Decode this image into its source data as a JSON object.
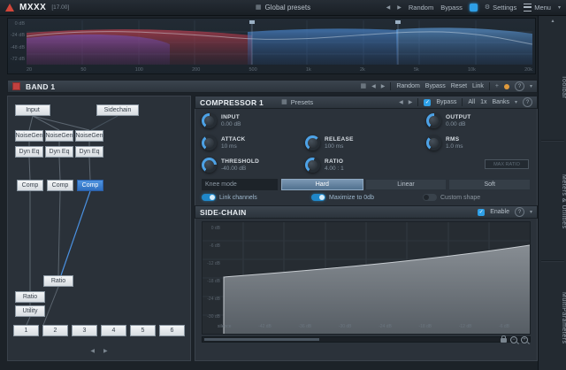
{
  "titlebar": {
    "app": "MXXX",
    "version": "[17.00]",
    "global_presets": "Global presets",
    "random": "Random",
    "bypass": "Bypass",
    "settings": "Settings",
    "menu": "Menu"
  },
  "icons": {
    "grid": "▦",
    "arrow_left": "◀",
    "arrow_right": "▶",
    "caret_down": "▾",
    "up": "▴",
    "help": "?",
    "plus": "+",
    "minus": "−",
    "check": "✓",
    "gear": "⚙",
    "dot": "●"
  },
  "spectrum": {
    "db_labels": [
      "0 dB",
      "-24 dB",
      "-48 dB",
      "-72 dB"
    ],
    "freq_labels": [
      "20",
      "50",
      "100",
      "200",
      "500",
      "1k",
      "2k",
      "5k",
      "10k",
      "20k"
    ]
  },
  "band_header": {
    "title": "BAND 1",
    "actions": [
      "Random",
      "Bypass",
      "Reset",
      "Link"
    ]
  },
  "node_graph": {
    "input": "Input",
    "sidechain": "Sidechain",
    "noisegen": "NoiseGen",
    "dyneq": "Dyn Eq",
    "comp": "Comp",
    "ratio": "Ratio",
    "utility": "Utility",
    "slots": [
      "1",
      "2",
      "3",
      "4",
      "5",
      "6"
    ]
  },
  "compressor": {
    "title": "COMPRESSOR 1",
    "presets": "Presets",
    "bypass": "Bypass",
    "all": "All",
    "multi": "1x",
    "banks": "Banks",
    "knobs": [
      {
        "label": "INPUT",
        "value": "0.00 dB"
      },
      {
        "label": "ATTACK",
        "value": "10 ms"
      },
      {
        "label": "RELEASE",
        "value": "100 ms"
      },
      {
        "label": "THRESHOLD",
        "value": "-40.00 dB"
      },
      {
        "label": "RATIO",
        "value": "4.00 : 1"
      },
      {
        "label": "OUTPUT",
        "value": "0.00 dB"
      },
      {
        "label": "RMS",
        "value": "1.0 ms"
      }
    ],
    "aux_box": "MAX RATIO",
    "knee": {
      "label": "Knee mode",
      "options": [
        "Hard",
        "Linear",
        "Soft"
      ]
    },
    "toggles": [
      "Link channels",
      "Maximize to 0db",
      "Custom shape"
    ],
    "sidechain": {
      "title": "SIDE-CHAIN",
      "enable": "Enable"
    },
    "graph": {
      "x_labels": [
        "silence",
        "-42 dB",
        "-36 dB",
        "-30 dB",
        "-24 dB",
        "-18 dB",
        "-12 dB",
        "-6 dB"
      ],
      "y_labels": [
        "0 dB",
        "-6 dB",
        "-12 dB",
        "-18 dB",
        "-24 dB",
        "-30 dB"
      ]
    }
  },
  "rail": {
    "tabs": [
      "Toolbar",
      "Meters & Utilities",
      "MultiParameters"
    ]
  },
  "colors": {
    "accent": "#3f93e8",
    "band1": "#c1413f"
  }
}
